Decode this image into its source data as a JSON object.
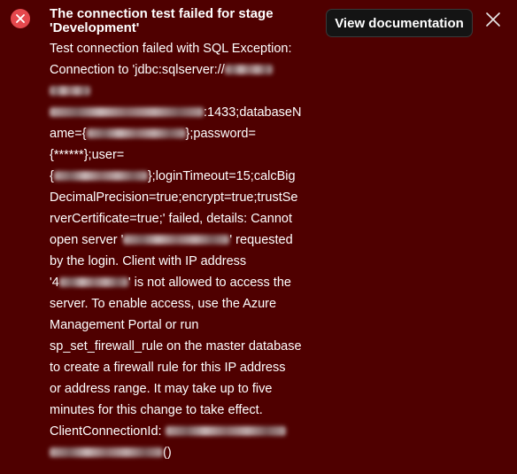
{
  "notification": {
    "title_line1": "The connection test failed for stage",
    "title_line2": "'Development'",
    "view_docs_label": "View documentation",
    "close_icon": "close-icon",
    "status_icon": "error-circle-icon",
    "colors": {
      "background": "#4f0000",
      "error_icon": "#e5484d",
      "button_bg": "#141414",
      "text": "#ffffff"
    },
    "message": {
      "l1": "Test connection failed with SQL Exception:",
      "l2": "Connection to 'jdbc:sqlserver://",
      "l4": ":1433;databaseN",
      "l5a": "ame={",
      "l5b": "};password=",
      "l6": "{******};user=",
      "l7a": "{",
      "l7b": "};loginTimeout=15;calcBig",
      "l8": "DecimalPrecision=true;encrypt=true;trustSe",
      "l9": "rverCertificate=true;' failed, details: Cannot",
      "l10a": "open server '",
      "l10b": "' requested",
      "l11": "by the login. Client with IP address",
      "l12a": "'4",
      "l12b": "' is not allowed to access the",
      "l13": "server. To enable access, use the Azure",
      "l14": "Management Portal or run",
      "l15": "sp_set_firewall_rule on the master database",
      "l16": "to create a firewall rule for this IP address",
      "l17": "or address range. It may take up to five",
      "l18": "minutes for this change to take effect.",
      "l19": "ClientConnectionId:",
      "l20": "()"
    }
  }
}
